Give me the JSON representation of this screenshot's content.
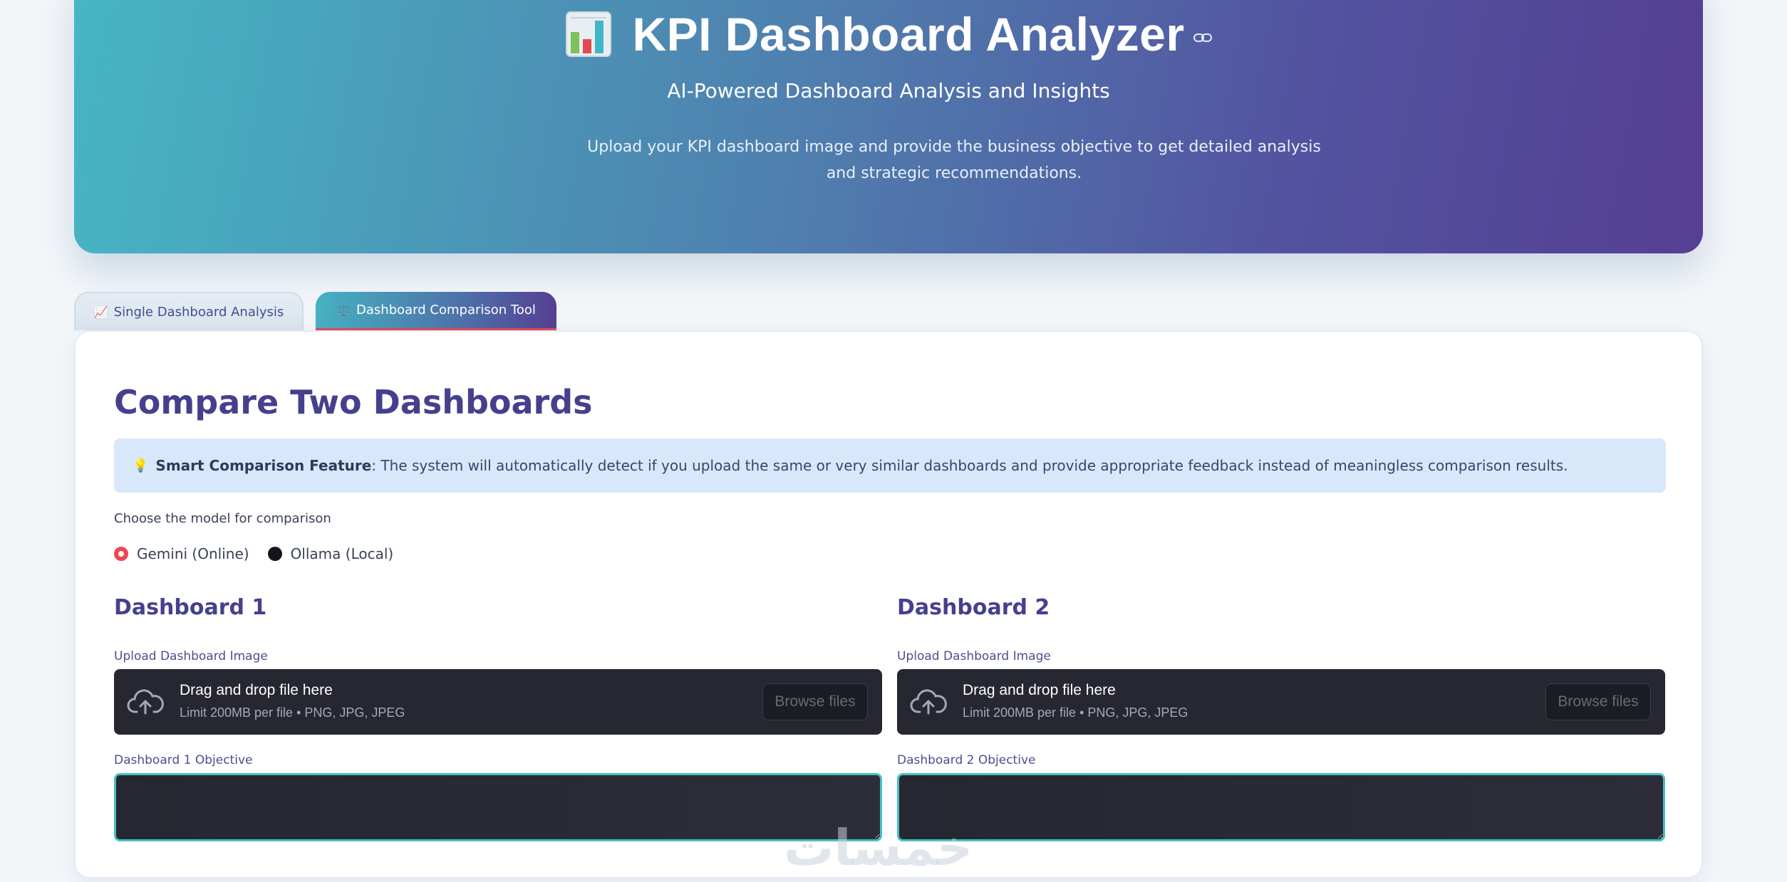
{
  "hero": {
    "title": "KPI Dashboard Analyzer",
    "subtitle": "AI-Powered Dashboard Analysis and Insights",
    "description": "Upload your KPI dashboard image and provide the business objective to get detailed analysis and strategic recommendations.",
    "colors": {
      "gradient_start": "#46b6c4",
      "gradient_end": "#553f92"
    }
  },
  "tabs": [
    {
      "icon": "📈",
      "label": "Single Dashboard Analysis",
      "active": false
    },
    {
      "icon": "⚖️",
      "label": "Dashboard Comparison Tool",
      "active": true
    }
  ],
  "main": {
    "title": "Compare Two Dashboards",
    "info": {
      "icon": "💡",
      "bold": "Smart Comparison Feature",
      "text": ": The system will automatically detect if you upload the same or very similar dashboards and provide appropriate feedback instead of meaningless comparison results."
    },
    "model_label": "Choose the model for comparison",
    "models": [
      {
        "label": "Gemini (Online)",
        "selected": true
      },
      {
        "label": "Ollama (Local)",
        "selected": false
      }
    ],
    "dashboards": [
      {
        "title": "Dashboard 1",
        "upload_label": "Upload Dashboard Image",
        "drop_text": "Drag and drop file here",
        "limit_text": "Limit 200MB per file • PNG, JPG, JPEG",
        "browse_label": "Browse files",
        "objective_label": "Dashboard 1 Objective",
        "objective_value": ""
      },
      {
        "title": "Dashboard 2",
        "upload_label": "Upload Dashboard Image",
        "drop_text": "Drag and drop file here",
        "limit_text": "Limit 200MB per file • PNG, JPG, JPEG",
        "browse_label": "Browse files",
        "objective_label": "Dashboard 2 Objective",
        "objective_value": ""
      }
    ]
  },
  "watermark": "خمسات",
  "accent": {
    "primary": "#45408e",
    "radio_selected": "#ef4654",
    "textarea_border": "#47c0c7"
  }
}
